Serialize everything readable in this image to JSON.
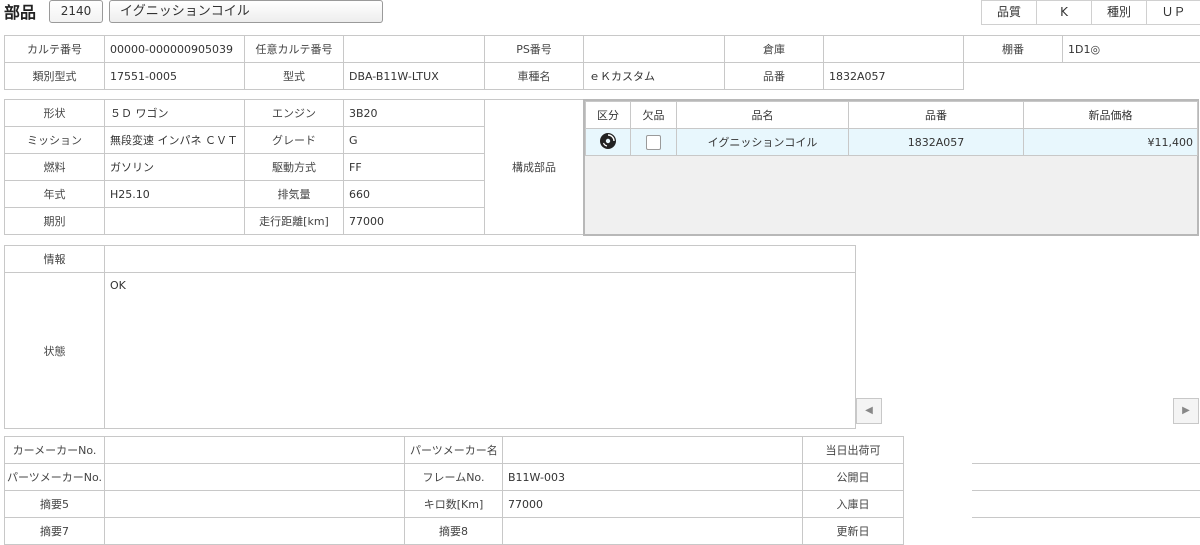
{
  "header": {
    "title": "部品",
    "code": "2140",
    "part_name": "イグニッションコイル",
    "right_cells": [
      "品質",
      "K",
      "種別",
      "ＵＰ"
    ]
  },
  "info_rows": [
    [
      "カルテ番号",
      "00000-000000905039",
      "任意カルテ番号",
      "",
      "PS番号",
      "",
      "倉庫",
      "",
      "棚番",
      "1D1◎"
    ],
    [
      "類別型式",
      "17551-0005",
      "型式",
      "DBA-B11W-LTUX",
      "車種名",
      "ｅＫカスタム",
      "品番",
      "1832A057"
    ]
  ],
  "spec": {
    "rows": [
      [
        "形状",
        "５Ｄ ワゴン",
        "エンジン",
        "3B20"
      ],
      [
        "ミッション",
        "無段変速 インパネ ＣＶＴ",
        "グレード",
        "G"
      ],
      [
        "燃料",
        "ガソリン",
        "駆動方式",
        "FF"
      ],
      [
        "年式",
        "H25.10",
        "排気量",
        "660"
      ],
      [
        "期別",
        "",
        "走行距離[km]",
        "77000"
      ]
    ],
    "component_label": "構成部品"
  },
  "parts_table": {
    "headers": [
      "区分",
      "欠品",
      "品名",
      "品番",
      "新品価格"
    ],
    "rows": [
      {
        "category_icon": "disc-icon",
        "missing": false,
        "name": "イグニッションコイル",
        "number": "1832A057",
        "price": "¥11,400"
      }
    ]
  },
  "notes": {
    "info_label": "情報",
    "info_value": "",
    "status_label": "状態",
    "status_value": "OK"
  },
  "scroll": {
    "left_icon": "◀",
    "right_icon": "▶"
  },
  "bottom_rows": [
    [
      "カーメーカーNo.",
      "",
      "パーツメーカー名",
      "",
      "当日出荷可",
      ""
    ],
    [
      "パーツメーカーNo.",
      "",
      "フレームNo.",
      "B11W-003",
      "公開日",
      ""
    ],
    [
      "摘要5",
      "",
      "キロ数[Km]",
      "77000",
      "入庫日",
      ""
    ],
    [
      "摘要7",
      "",
      "摘要8",
      "",
      "更新日",
      ""
    ]
  ]
}
